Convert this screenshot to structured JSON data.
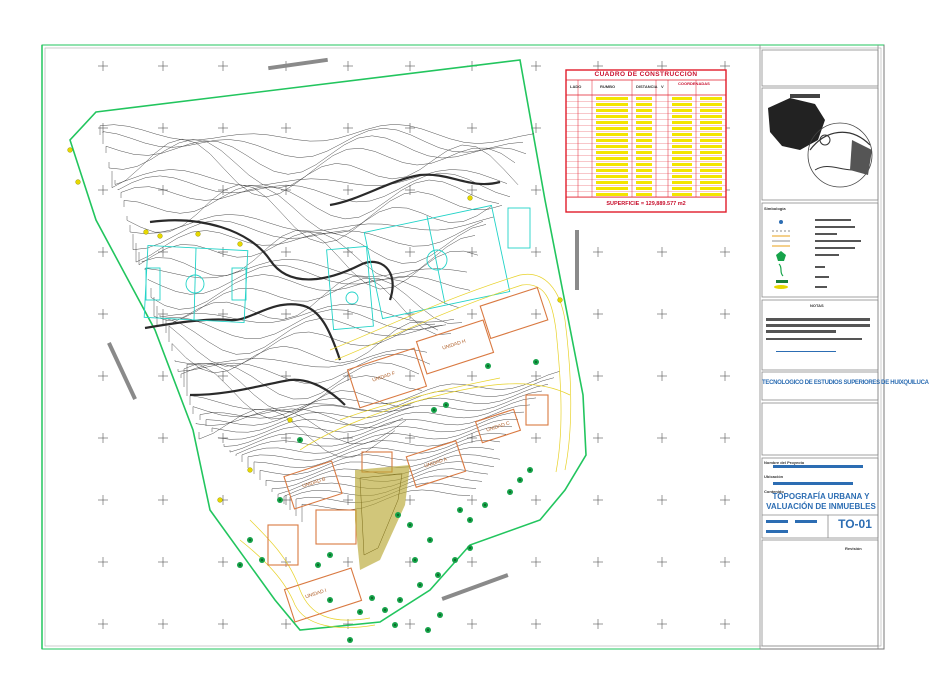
{
  "construction_table": {
    "title": "CUADRO DE CONSTRUCCION",
    "columns": [
      "LADO",
      "RUMBO",
      "DISTANCIA",
      "V",
      "COORDENADAS"
    ],
    "surface": "SUPERFICIE = 129,889.577 m2"
  },
  "title_block": {
    "drawing_title": "TOPOGRAFÍA URBANA Y VALUACIÓN DE INMUEBLES",
    "sheet_code": "TO-01",
    "institution": "TECNOLOGICO DE ESTUDIOS SUPERIORES DE HUIXQUILUCAN",
    "labels": {
      "simbologia": "Simbología",
      "notas": "NOTAS",
      "nombre_proyecto": "Nombre del Proyecto",
      "ubicacion": "Ubicación",
      "contenido": "Contenido",
      "revision": "Revisión"
    }
  },
  "buildings": [
    {
      "label": "UNIDAD F"
    },
    {
      "label": "UNIDAD H"
    },
    {
      "label": "UNIDAD A"
    },
    {
      "label": "UNIDAD C"
    },
    {
      "label": "UNIDAD B"
    },
    {
      "label": "UNIDAD I"
    }
  ],
  "colors": {
    "boundary": "#22c55e",
    "sports_fields": "#22d3c8",
    "contours": "#3a3a3a",
    "buildings": "#d97941",
    "table_red": "#e11d2a",
    "table_yellow": "#f3e500",
    "title_blue": "#2c6db3",
    "vegetation": "#16a34a"
  }
}
